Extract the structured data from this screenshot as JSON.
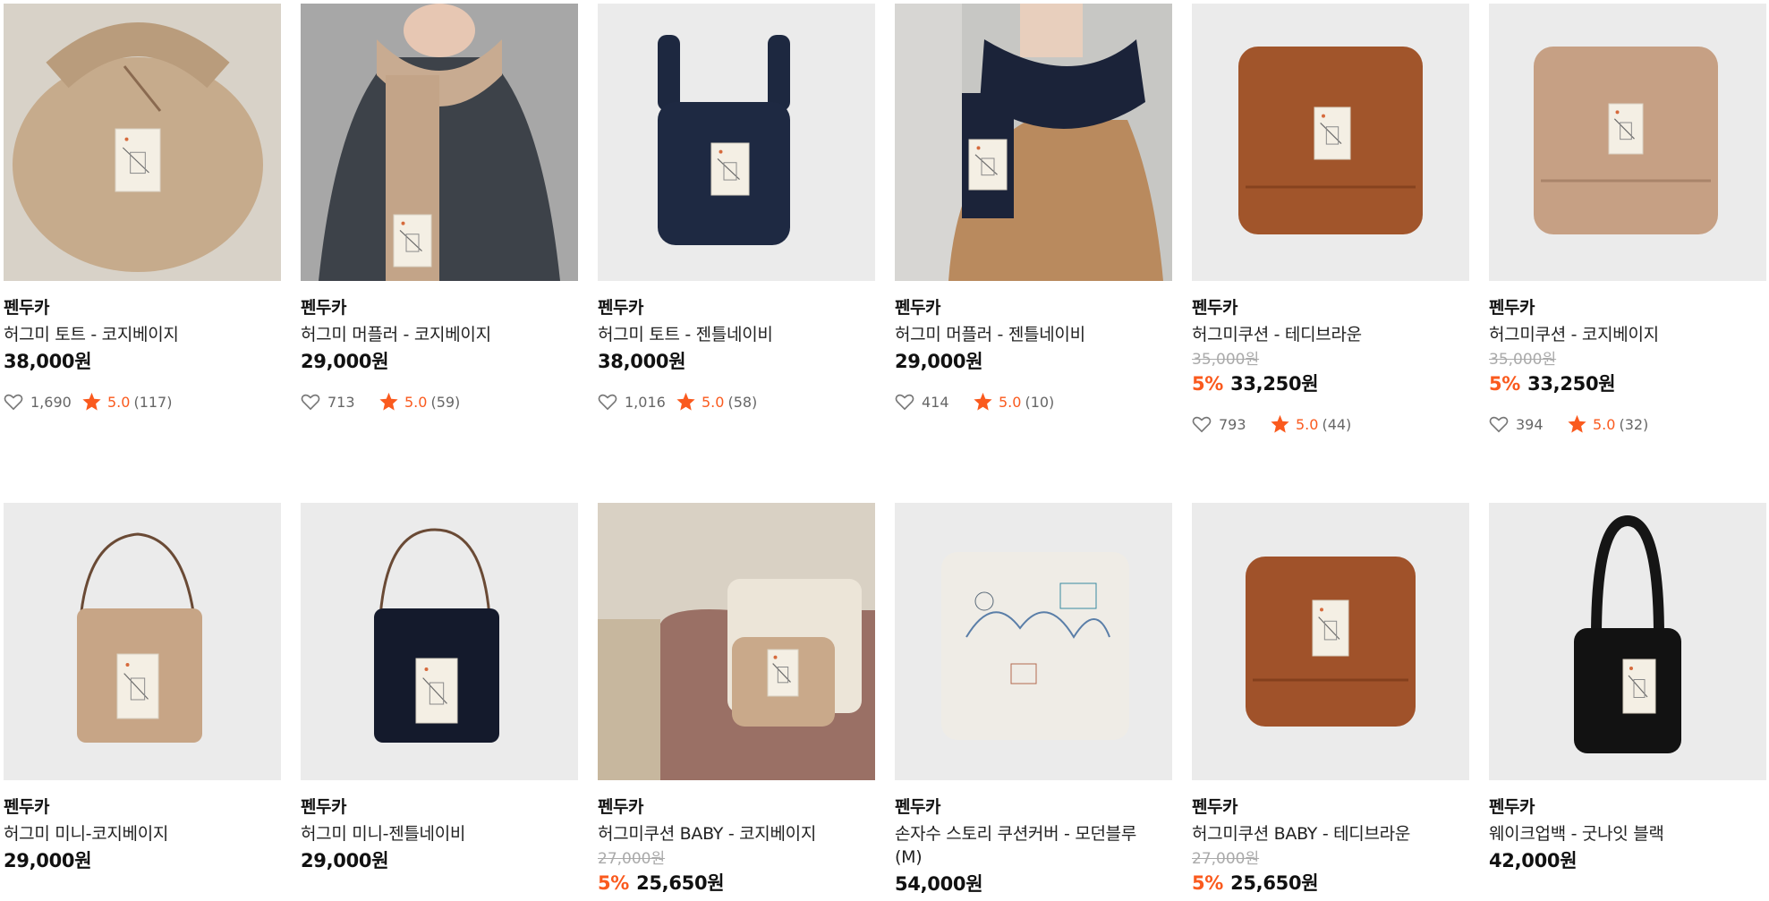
{
  "colors": {
    "accent": "#fa5a1e",
    "thumb_bg": "#ebebeb"
  },
  "products": [
    {
      "brand": "펜두카",
      "name": "허그미 토트 - 코지베이지",
      "original": "",
      "discount": "",
      "price": "38,000원",
      "likes": "1,690",
      "score": "5.0",
      "reviews": "(117)",
      "image": "tote-beige"
    },
    {
      "brand": "펜두카",
      "name": "허그미 머플러 - 코지베이지",
      "original": "",
      "discount": "",
      "price": "29,000원",
      "likes": "713",
      "score": "5.0",
      "reviews": "(59)",
      "image": "muffler-beige"
    },
    {
      "brand": "펜두카",
      "name": "허그미 토트 - 젠틀네이비",
      "original": "",
      "discount": "",
      "price": "38,000원",
      "likes": "1,016",
      "score": "5.0",
      "reviews": "(58)",
      "image": "tote-navy"
    },
    {
      "brand": "펜두카",
      "name": "허그미 머플러 - 젠틀네이비",
      "original": "",
      "discount": "",
      "price": "29,000원",
      "likes": "414",
      "score": "5.0",
      "reviews": "(10)",
      "image": "muffler-navy"
    },
    {
      "brand": "펜두카",
      "name": "허그미쿠션 - 테디브라운",
      "original": "35,000원",
      "discount": "5%",
      "price": "33,250원",
      "likes": "793",
      "score": "5.0",
      "reviews": "(44)",
      "image": "cushion-brown"
    },
    {
      "brand": "펜두카",
      "name": "허그미쿠션 - 코지베이지",
      "original": "35,000원",
      "discount": "5%",
      "price": "33,250원",
      "likes": "394",
      "score": "5.0",
      "reviews": "(32)",
      "image": "cushion-beige"
    },
    {
      "brand": "펜두카",
      "name": "허그미 미니-코지베이지",
      "original": "",
      "discount": "",
      "price": "29,000원",
      "likes": "",
      "score": "",
      "reviews": "",
      "image": "mini-beige"
    },
    {
      "brand": "펜두카",
      "name": "허그미 미니-젠틀네이비",
      "original": "",
      "discount": "",
      "price": "29,000원",
      "likes": "",
      "score": "",
      "reviews": "",
      "image": "mini-navy"
    },
    {
      "brand": "펜두카",
      "name": "허그미쿠션 BABY - 코지베이지",
      "original": "27,000원",
      "discount": "5%",
      "price": "25,650원",
      "likes": "",
      "score": "",
      "reviews": "",
      "image": "baby-beige-room"
    },
    {
      "brand": "펜두카",
      "name": "손자수 스토리 쿠션커버 - 모던블루(M)",
      "original": "",
      "discount": "",
      "price": "54,000원",
      "likes": "",
      "score": "",
      "reviews": "",
      "image": "story-cushion"
    },
    {
      "brand": "펜두카",
      "name": "허그미쿠션 BABY - 테디브라운",
      "original": "27,000원",
      "discount": "5%",
      "price": "25,650원",
      "likes": "",
      "score": "",
      "reviews": "",
      "image": "baby-brown"
    },
    {
      "brand": "펜두카",
      "name": "웨이크업백 - 굿나잇 블랙",
      "original": "",
      "discount": "",
      "price": "42,000원",
      "likes": "",
      "score": "",
      "reviews": "",
      "image": "wakeup-black"
    }
  ]
}
